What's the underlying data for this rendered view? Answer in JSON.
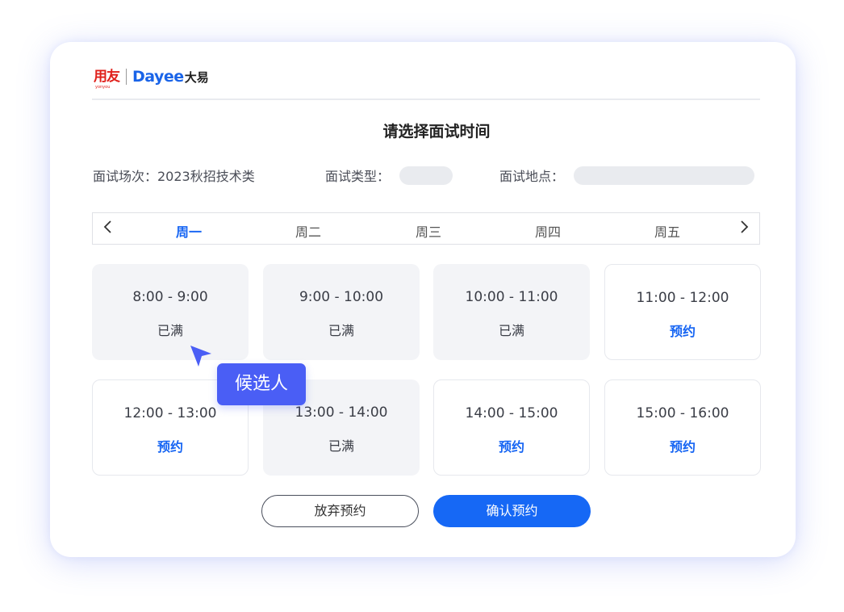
{
  "logo": {
    "brand_cn": "用友",
    "brand_en": "yonyou",
    "dayee_d": "D",
    "dayee_rest": "ayee",
    "dayee_cn": "大易"
  },
  "title": "请选择面试时间",
  "info": {
    "session": "面试场次：2023秋招技术类",
    "type_label": "面试类型：",
    "place_label": "面试地点："
  },
  "week": {
    "prev": "<",
    "next": ">",
    "days": [
      "周一",
      "周二",
      "周三",
      "周四",
      "周五"
    ],
    "active_index": 0
  },
  "slots": [
    {
      "time": "8:00 - 9:00",
      "status": "已满"
    },
    {
      "time": "9:00 - 10:00",
      "status": "已满"
    },
    {
      "time": "10:00 - 11:00",
      "status": "已满"
    },
    {
      "time": "11:00 - 12:00",
      "status": "预约"
    },
    {
      "time": "12:00 - 13:00",
      "status": "预约"
    },
    {
      "time": "13:00 - 14:00",
      "status": "已满"
    },
    {
      "time": "14:00 - 15:00",
      "status": "预约"
    },
    {
      "time": "15:00 - 16:00",
      "status": "预约"
    }
  ],
  "buttons": {
    "cancel": "放弃预约",
    "confirm": "确认预约"
  },
  "cursor_tag": "候选人",
  "colors": {
    "accent": "#1665f3",
    "tag": "#4a5ef5",
    "full_bg": "#f3f4f7"
  }
}
